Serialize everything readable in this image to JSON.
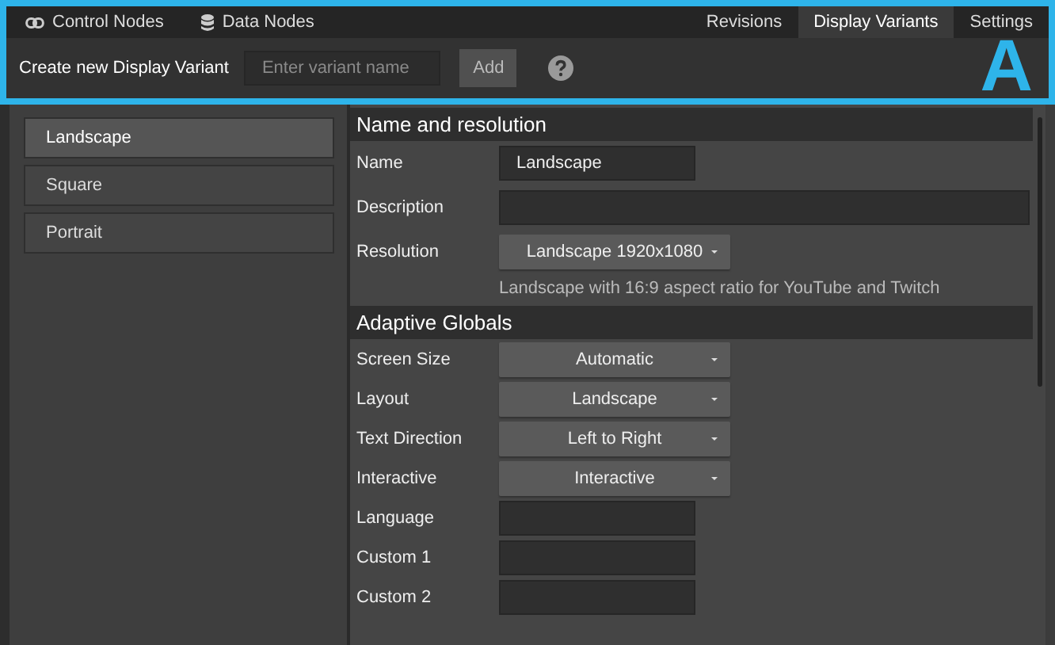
{
  "callout": {
    "label": "A"
  },
  "nav": {
    "left_tabs": [
      {
        "label": "Control Nodes"
      },
      {
        "label": "Data Nodes"
      }
    ],
    "right_tabs": [
      {
        "label": "Revisions",
        "selected": false
      },
      {
        "label": "Display Variants",
        "selected": true
      },
      {
        "label": "Settings",
        "selected": false
      }
    ]
  },
  "create_bar": {
    "label": "Create new Display Variant",
    "placeholder": "Enter variant name",
    "button": "Add"
  },
  "variants": [
    {
      "label": "Landscape",
      "selected": true
    },
    {
      "label": "Square",
      "selected": false
    },
    {
      "label": "Portrait",
      "selected": false
    }
  ],
  "sections": [
    {
      "title": "Name and resolution",
      "fields": [
        {
          "kind": "input",
          "label": "Name",
          "value": "Landscape"
        },
        {
          "kind": "wide-input",
          "label": "Description"
        },
        {
          "kind": "select",
          "label": "Resolution",
          "value": "Landscape 1920x1080",
          "hint": "Landscape with 16:9 aspect ratio for YouTube and Twitch"
        }
      ]
    },
    {
      "title": "Adaptive Globals",
      "fields": [
        {
          "kind": "select",
          "label": "Screen Size",
          "value": "Automatic"
        },
        {
          "kind": "select",
          "label": "Layout",
          "value": "Landscape"
        },
        {
          "kind": "select",
          "label": "Text Direction",
          "value": "Left to Right"
        },
        {
          "kind": "select",
          "label": "Interactive",
          "value": "Interactive"
        },
        {
          "kind": "input",
          "label": "Language"
        },
        {
          "kind": "input",
          "label": "Custom 1"
        },
        {
          "kind": "input",
          "label": "Custom 2"
        }
      ]
    }
  ]
}
